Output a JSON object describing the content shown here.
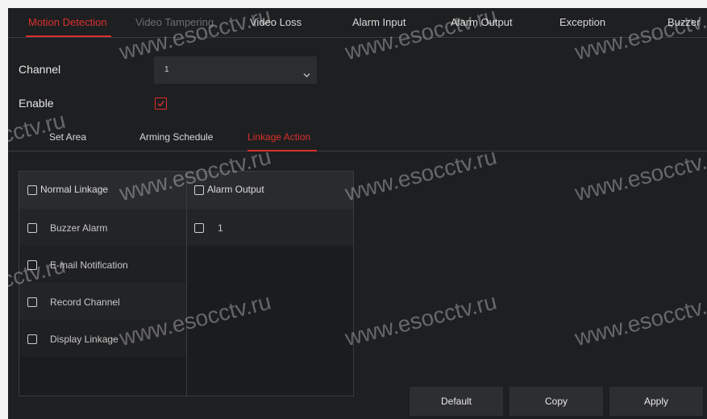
{
  "top_tabs": [
    {
      "label": "Motion Detection"
    },
    {
      "label": "Video Tampering"
    },
    {
      "label": "Video Loss"
    },
    {
      "label": "Alarm Input"
    },
    {
      "label": "Alarm Output"
    },
    {
      "label": "Exception"
    },
    {
      "label": "Buzzer"
    }
  ],
  "active_top_tab": "Motion Detection",
  "form": {
    "channel_label": "Channel",
    "channel_value": "1",
    "enable_label": "Enable",
    "enable_checked": true
  },
  "sub_tabs": [
    {
      "label": "Set Area"
    },
    {
      "label": "Arming Schedule"
    },
    {
      "label": "Linkage Action"
    }
  ],
  "active_sub_tab": "Linkage Action",
  "linkage": {
    "normal_linkage": {
      "header": "Normal Linkage",
      "items": [
        {
          "label": "Buzzer Alarm",
          "checked": false
        },
        {
          "label": "E-mail Notification",
          "checked": false
        },
        {
          "label": "Record Channel",
          "checked": false
        },
        {
          "label": "Display Linkage",
          "checked": false
        }
      ]
    },
    "alarm_output": {
      "header": "Alarm Output",
      "items": [
        {
          "label": "1",
          "checked": false
        }
      ]
    }
  },
  "buttons": {
    "default": "Default",
    "copy": "Copy",
    "apply": "Apply"
  },
  "watermark": "www.esocctv.ru",
  "colors": {
    "accent": "#d9302c",
    "background": "#1e1f21",
    "panel_header": "#2a2b2e",
    "button": "#2d2e31"
  }
}
